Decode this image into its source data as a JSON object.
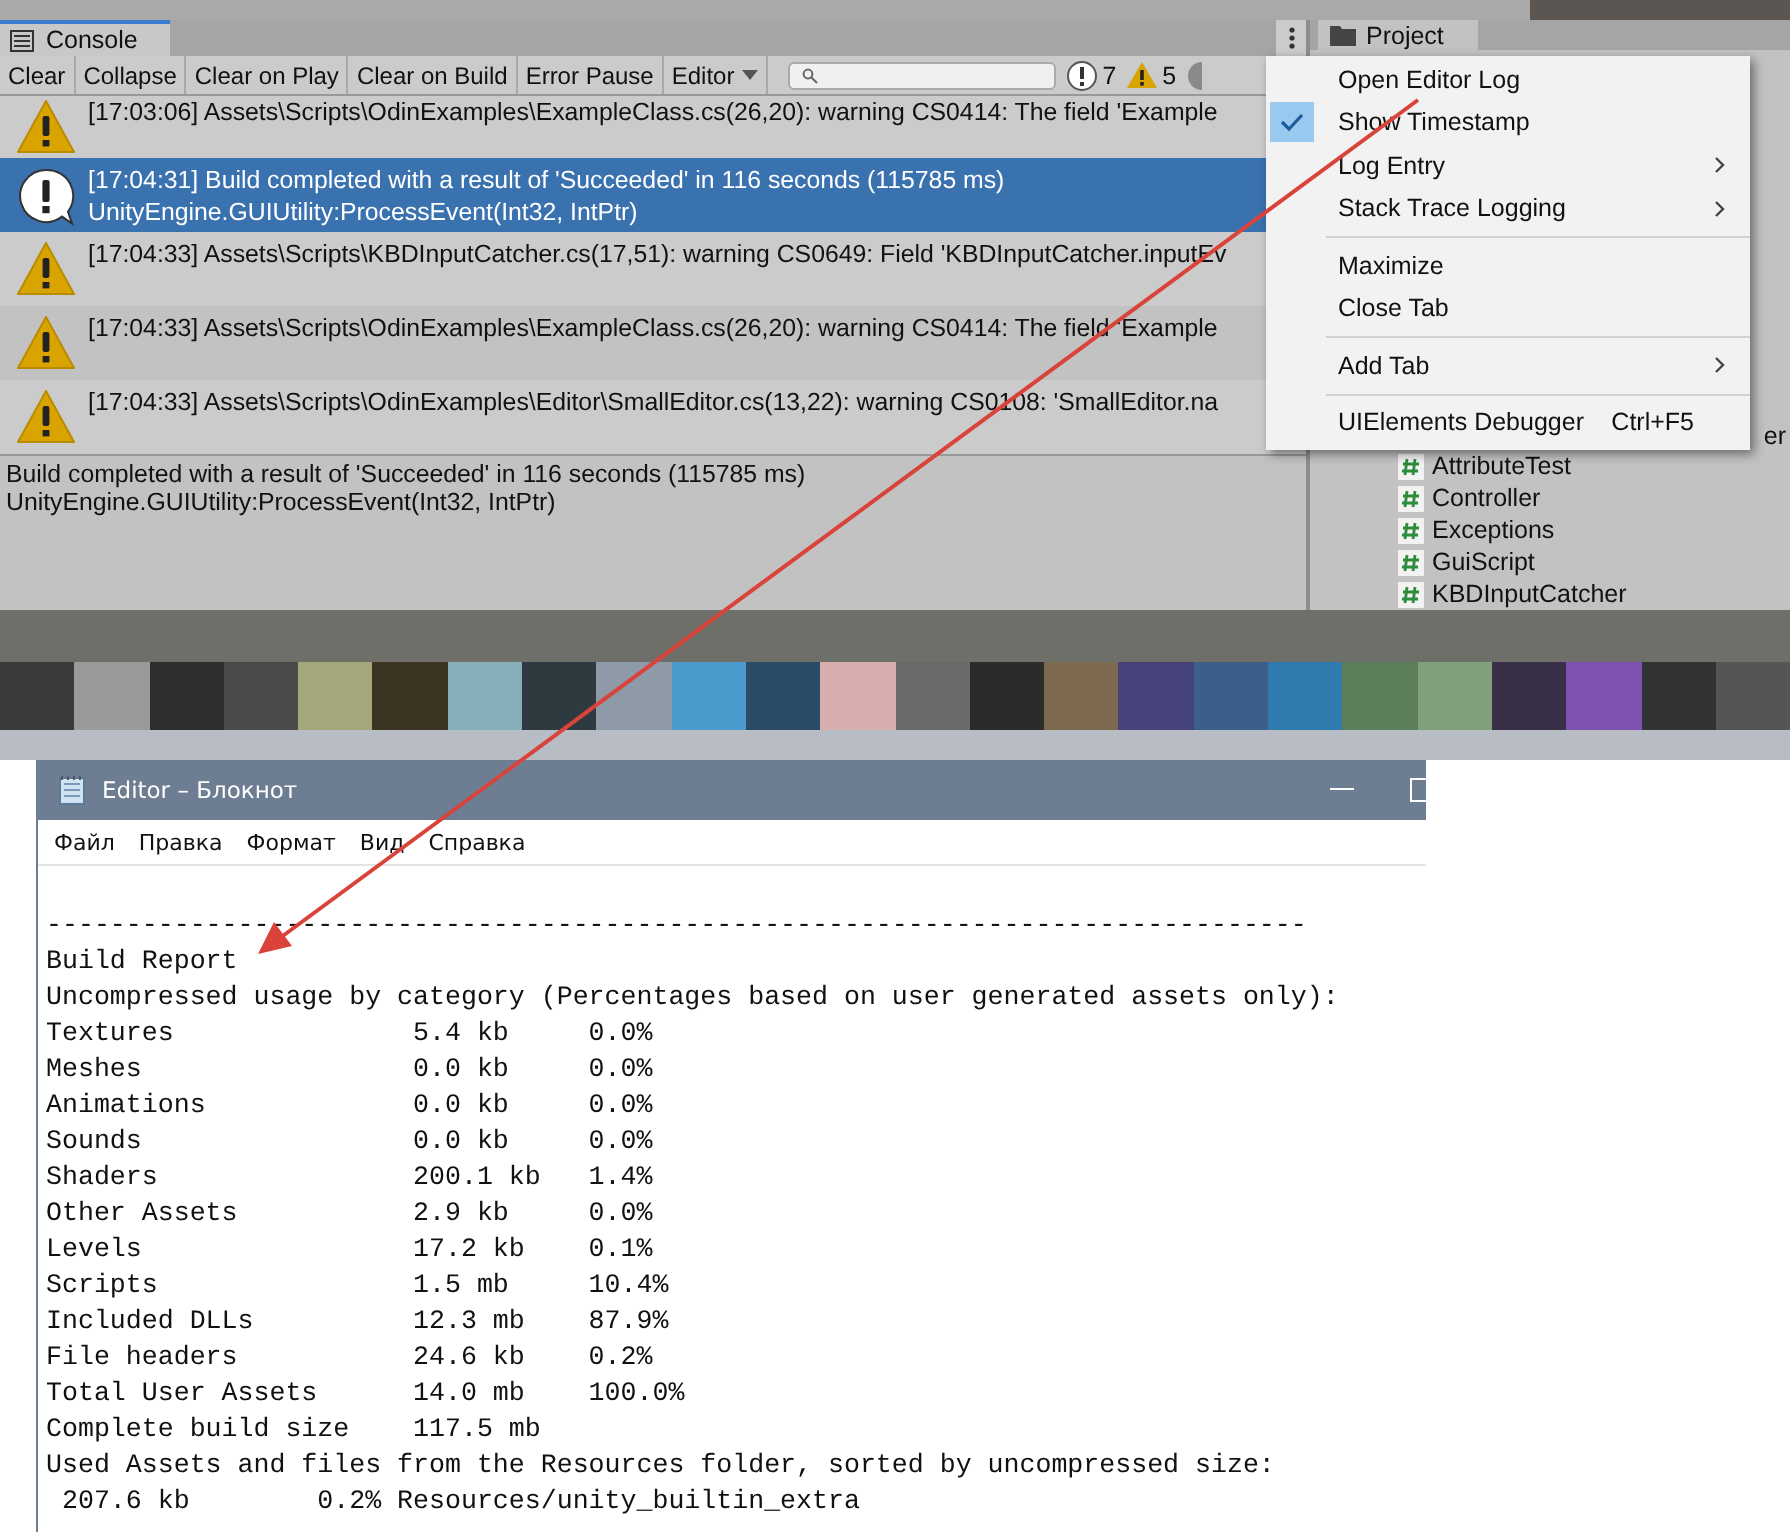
{
  "console": {
    "tab": "Console",
    "toolbar": [
      {
        "label": "Clear",
        "kind": "button",
        "on": false
      },
      {
        "label": "Collapse",
        "kind": "button",
        "on": false
      },
      {
        "label": "Clear on Play",
        "kind": "button",
        "on": false
      },
      {
        "label": "Clear on Build",
        "kind": "button",
        "on": false
      },
      {
        "label": "Error Pause",
        "kind": "button",
        "on": false
      },
      {
        "label": "Editor",
        "kind": "dropdown",
        "on": false
      }
    ],
    "counts": [
      {
        "kind": "info",
        "count": "7"
      },
      {
        "kind": "warning",
        "count": "5"
      },
      {
        "kind": "error"
      }
    ],
    "entries": [
      {
        "kind": "warning",
        "selected": false,
        "text": "[17:03:06] Assets\\Scripts\\OdinExamples\\ExampleClass.cs(26,20): warning CS0414: The field 'Example"
      },
      {
        "kind": "info",
        "selected": true,
        "text": "[17:04:31] Build completed with a result of 'Succeeded' in 116 seconds (115785 ms)",
        "stack": "UnityEngine.GUIUtility:ProcessEvent(Int32, IntPtr)"
      },
      {
        "kind": "warning",
        "selected": false,
        "text": "[17:04:33] Assets\\Scripts\\KBDInputCatcher.cs(17,51): warning CS0649: Field 'KBDInputCatcher.inputEv"
      },
      {
        "kind": "warning",
        "selected": false,
        "text": "[17:04:33] Assets\\Scripts\\OdinExamples\\ExampleClass.cs(26,20): warning CS0414: The field 'Example"
      },
      {
        "kind": "warning",
        "selected": false,
        "text": "[17:04:33] Assets\\Scripts\\OdinExamples\\Editor\\SmallEditor.cs(13,22): warning CS0108: 'SmallEditor.na"
      }
    ],
    "details": [
      "Build completed with a result of 'Succeeded' in 116 seconds (115785 ms)",
      "UnityEngine.GUIUtility:ProcessEvent(Int32, IntPtr)"
    ]
  },
  "context_menu": {
    "items": [
      {
        "kind": "item",
        "label": "Open Editor Log",
        "checked": false,
        "submenu": false
      },
      {
        "kind": "item",
        "label": "Show Timestamp",
        "checked": true,
        "submenu": false
      },
      {
        "kind": "item",
        "label": "Log Entry",
        "checked": false,
        "submenu": true
      },
      {
        "kind": "item",
        "label": "Stack Trace Logging",
        "checked": false,
        "submenu": true
      },
      {
        "kind": "separator"
      },
      {
        "kind": "item",
        "label": "Maximize",
        "checked": false,
        "submenu": false
      },
      {
        "kind": "item",
        "label": "Close Tab",
        "checked": false,
        "submenu": false
      },
      {
        "kind": "separator"
      },
      {
        "kind": "item",
        "label": "Add Tab",
        "checked": false,
        "submenu": true
      },
      {
        "kind": "separator"
      },
      {
        "kind": "item",
        "label": "UIElements Debugger",
        "checked": false,
        "submenu": false,
        "shortcut": "Ctrl+F5"
      }
    ]
  },
  "project": {
    "tab": "Project",
    "partial_item": "er",
    "items": [
      "AttributeTest",
      "Controller",
      "Exceptions",
      "GuiScript",
      "KBDInputCatcher"
    ]
  },
  "notepad": {
    "title": "Editor – Блокнот",
    "menu": [
      "Файл",
      "Правка",
      "Формат",
      "Вид",
      "Справка"
    ],
    "lines": [
      "-------------------------------------------------------------------------------",
      "Build Report",
      "Uncompressed usage by category (Percentages based on user generated assets only):",
      "Textures               5.4 kb     0.0%",
      "Meshes                 0.0 kb     0.0%",
      "Animations             0.0 kb     0.0%",
      "Sounds                 0.0 kb     0.0%",
      "Shaders                200.1 kb   1.4%",
      "Other Assets           2.9 kb     0.0%",
      "Levels                 17.2 kb    0.1%",
      "Scripts                1.5 mb     10.4%",
      "Included DLLs          12.3 mb    87.9%",
      "File headers           24.6 kb    0.2%",
      "Total User Assets      14.0 mb    100.0%",
      "Complete build size    117.5 mb",
      "Used Assets and files from the Resources folder, sorted by uncompressed size:",
      " 207.6 kb        0.2% Resources/unity_builtin_extra"
    ]
  }
}
